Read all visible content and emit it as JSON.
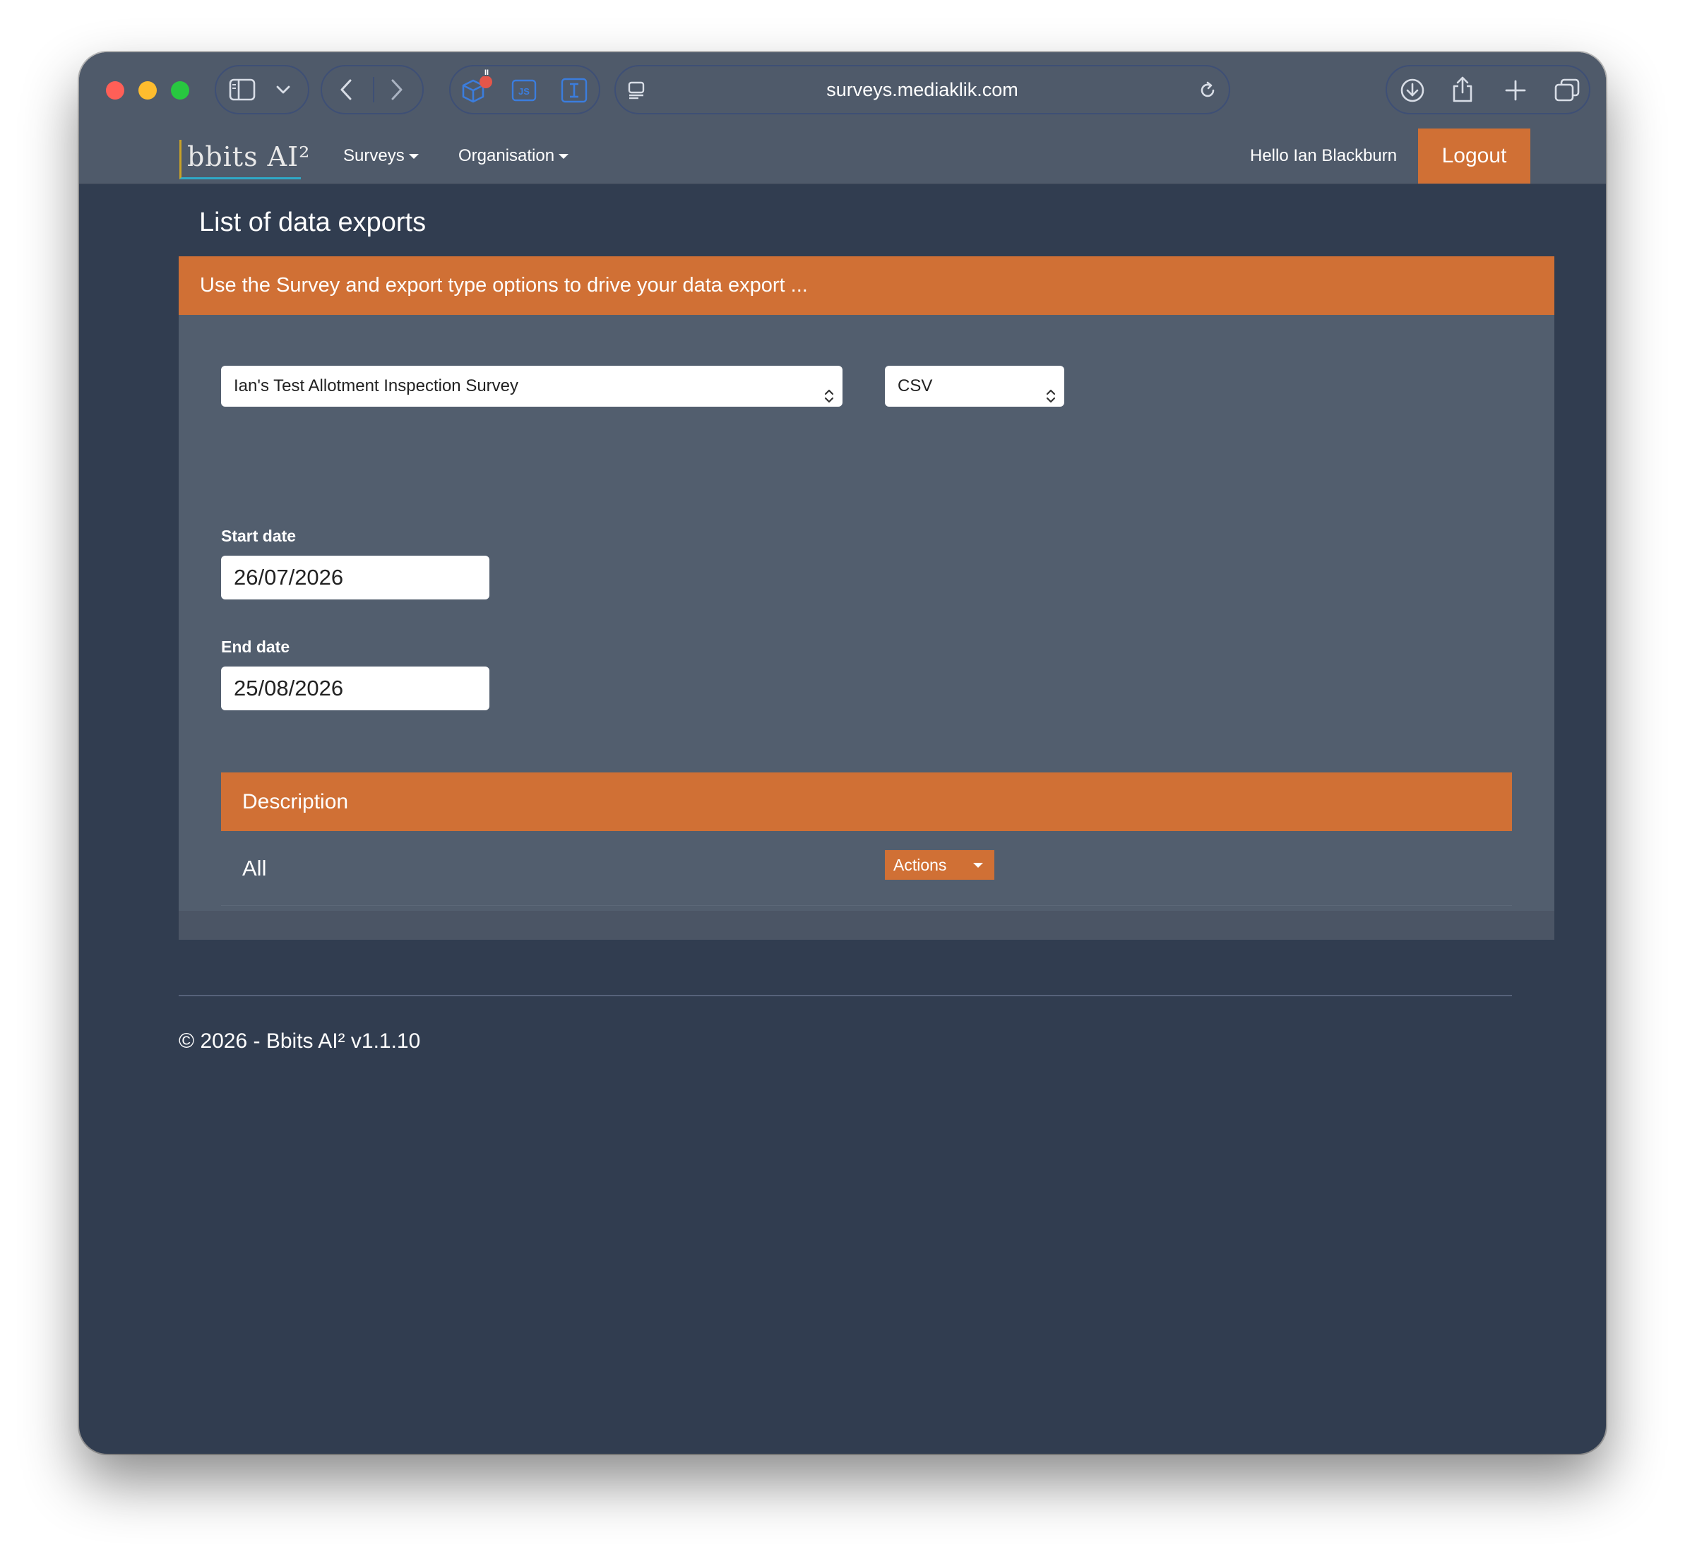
{
  "browser": {
    "url": "surveys.mediaklik.com",
    "extension_badge": "II"
  },
  "navbar": {
    "logo": "bbits AI²",
    "menu": [
      {
        "label": "Surveys"
      },
      {
        "label": "Organisation"
      }
    ],
    "greeting": "Hello Ian Blackburn",
    "logout_label": "Logout"
  },
  "page": {
    "title": "List of data exports",
    "panel_header": "Use the Survey and export type options to drive your data export ..."
  },
  "filters": {
    "survey_selected": "Ian's Test Allotment Inspection Survey",
    "export_type_selected": "CSV",
    "start_date_label": "Start date",
    "start_date_value": "26/07/2026",
    "end_date_label": "End date",
    "end_date_value": "25/08/2026"
  },
  "table": {
    "header": "Description",
    "rows": [
      {
        "description": "All",
        "actions_label": "Actions"
      }
    ]
  },
  "footer": {
    "text": "© 2026 - Bbits AI² v1.1.10"
  },
  "colors": {
    "accent": "#d07035",
    "background": "#313d50",
    "panel": "#525e6e",
    "navbar": "#4f5a6a"
  }
}
